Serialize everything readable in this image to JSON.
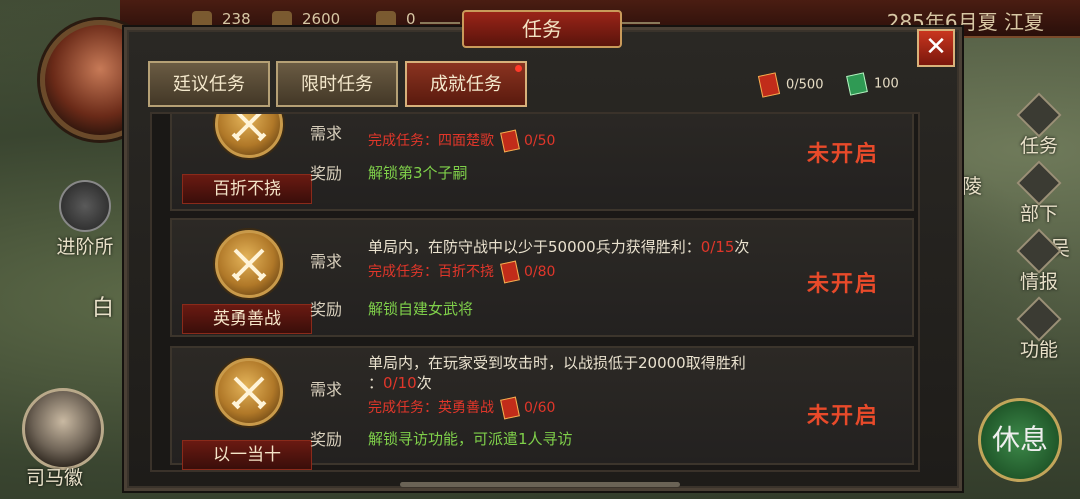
{
  "resources": [
    {
      "icon": "grain-icon",
      "value": "238"
    },
    {
      "icon": "coin-icon",
      "value": "2600"
    },
    {
      "icon": "troop-icon",
      "value": "0"
    }
  ],
  "date_location": "285年6月夏 江夏",
  "left_menu": {
    "advance_label": "进阶所",
    "map_text": "白"
  },
  "advisor_name": "司马徽",
  "map_labels": {
    "ling": "陵",
    "wu": "吴"
  },
  "right_menu": [
    "任务",
    "部下",
    "情报",
    "功能"
  ],
  "rest_button": "休息",
  "panel": {
    "title": "任务",
    "close": "✕",
    "tabs": [
      {
        "label": "廷议任务",
        "active": false
      },
      {
        "label": "限时任务",
        "active": false
      },
      {
        "label": "成就任务",
        "active": true
      }
    ],
    "token_count": "0/500",
    "jade_count": "100",
    "req_label": "需求",
    "reward_label": "奖励",
    "tasks": [
      {
        "name": "百折不挠",
        "desc_pre": "",
        "desc_prog": "",
        "desc_post": "",
        "req_text": "完成任务：四面楚歌",
        "req_prog": "0/50",
        "reward": "解锁第3个子嗣",
        "status": "未开启"
      },
      {
        "name": "英勇善战",
        "desc_pre": "单局内，在防守战中以少于50000兵力获得胜利：",
        "desc_prog": "0/15",
        "desc_post": "次",
        "req_text": "完成任务：百折不挠",
        "req_prog": "0/80",
        "reward": "解锁自建女武将",
        "status": "未开启"
      },
      {
        "name": "以一当十",
        "desc_pre": "单局内，在玩家受到攻击时，以战损低于20000取得胜利",
        "desc_line2_pre": "：",
        "desc_prog": "0/10",
        "desc_post": "次",
        "req_text": "完成任务：英勇善战",
        "req_prog": "0/60",
        "reward": "解锁寻访功能，可派遣1人寻访",
        "status": "未开启"
      }
    ]
  }
}
